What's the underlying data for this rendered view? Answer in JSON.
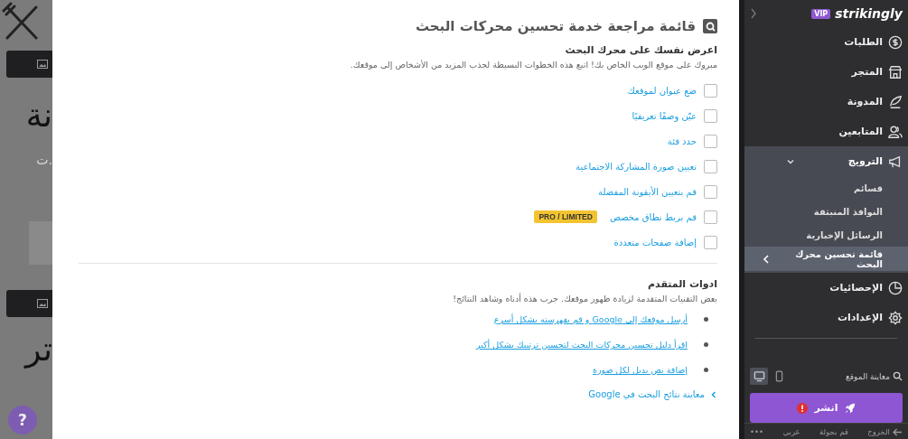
{
  "backdrop": {
    "texts": [
      {
        "kind": "heading",
        "text": "نة"
      },
      {
        "kind": "caption",
        "text": "ت."
      },
      {
        "kind": "heading",
        "text": "تر"
      }
    ],
    "help": "?"
  },
  "modal": {
    "title": "قائمة مراجعة خدمة تحسين محركات البحث",
    "intro": {
      "heading": "اعرض نفسك على محرك البحث",
      "text": "مبروك على موقع الويب الخاص بك! اتبع هذه الخطوات البسيطة لجذب المزيد من الأشخاص إلى موقعك."
    },
    "checklist": [
      {
        "label": "ضع عنوان لموقعك",
        "checked": false
      },
      {
        "label": "عيّن وصفًا تعريفيًا",
        "checked": false
      },
      {
        "label": "حدد فئة",
        "checked": false
      },
      {
        "label": "تعيين صورة المشاركة الاجتماعية",
        "checked": false
      },
      {
        "label": "قم بتعيين الأيقونة المفضلة",
        "checked": false
      },
      {
        "label": "قم بربط نطاق مخصص",
        "checked": false,
        "badge": "PRO / LIMITED"
      },
      {
        "label": "إضافة صفحات متعددة",
        "checked": false
      }
    ],
    "advanced": {
      "heading": "ادوات المتقدم",
      "text": "بعض التقنيات المتقدمة لزيادة ظهور موقعك. جرب هذه أدناه وشاهد النتائج!",
      "links": [
        "أرسل موقعك إلى Google و قم بفهرسته بشكل أسرع",
        "اقرأ دليل تحسين محركات البحث لتحسين ترتيبك بشكل أكبر",
        "إضافة نص بديل لكل صورة"
      ]
    },
    "footer_link": "معاينة نتائج البحث في Google"
  },
  "sidebar": {
    "logo": "strikingly",
    "plan": "VIP",
    "nav": [
      {
        "label": "الطلبات"
      },
      {
        "label": "المتجر"
      },
      {
        "label": "المدونة"
      },
      {
        "label": "المتابعين"
      },
      {
        "label": "الترويج",
        "expanded": true,
        "children": [
          {
            "label": "قسائم",
            "selected": false
          },
          {
            "label": "النوافذ المنبثقة",
            "selected": false
          },
          {
            "label": "الرسائل الإخبارية",
            "selected": false
          },
          {
            "label": "قائمة تحسين محرك البحث",
            "selected": true
          }
        ]
      },
      {
        "label": "الإحصائيات"
      },
      {
        "label": "الإعدادات"
      }
    ],
    "preview": {
      "label": "معاينة الموقع",
      "devices": [
        {
          "kind": "mobile",
          "selected": false
        },
        {
          "kind": "desktop",
          "selected": true
        }
      ]
    },
    "publish": "انشر",
    "footer": [
      "الخروج",
      "قم بجولة",
      "عربي",
      "•••"
    ]
  }
}
